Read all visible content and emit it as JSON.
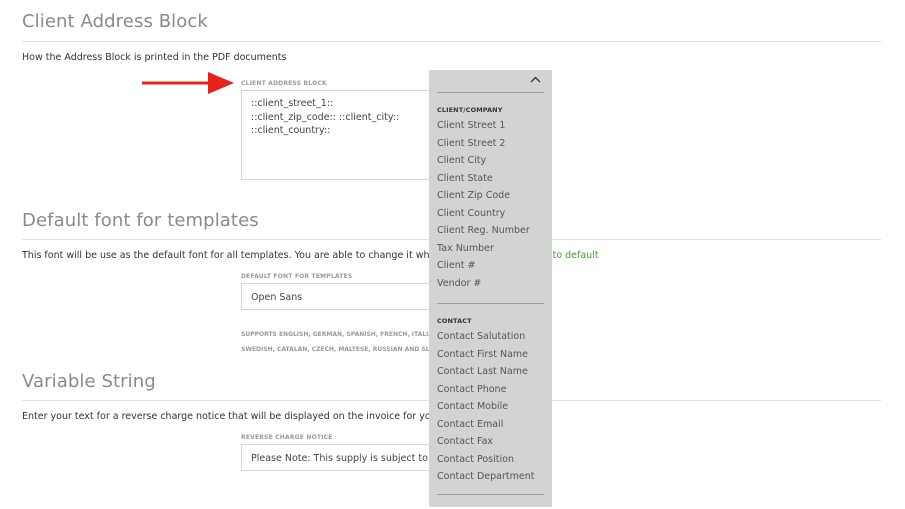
{
  "sections": {
    "address": {
      "title": "Client Address Block",
      "description": "How the Address Block is printed in the PDF documents",
      "field_label": "CLIENT ADDRESS BLOCK",
      "lines": [
        "::client_street_1::",
        "::client_zip_code:: ::client_city::",
        "::client_country::"
      ]
    },
    "font": {
      "title": "Default font for templates",
      "description": "This font will be use as the default font for all templates. You are able to change it when cu",
      "reset_link": "et to default",
      "field_label": "DEFAULT FONT FOR TEMPLATES",
      "value": "Open Sans",
      "help_line1": "SUPPORTS ENGLISH, GERMAN, SPANISH, FRENCH, ITALIA",
      "help_line2": "SWEDISH, CATALAN, CZECH, MALTESE, RUSSIAN AND SLO"
    },
    "variable": {
      "title": "Variable String",
      "description": "Enter your text for a reverse charge notice that will be displayed on the invoice for your cli",
      "field_label": "REVERSE CHARGE NOTICE",
      "value": "Please Note: This supply is subject to th"
    }
  },
  "dropdown": {
    "groups": [
      {
        "title": "CLIENT/COMPANY",
        "items": [
          "Client Street 1",
          "Client Street 2",
          "Client City",
          "Client State",
          "Client Zip Code",
          "Client Country",
          "Client Reg. Number",
          "Tax Number",
          "Client #",
          "Vendor #"
        ]
      },
      {
        "title": "CONTACT",
        "items": [
          "Contact Salutation",
          "Contact First Name",
          "Contact Last Name",
          "Contact Phone",
          "Contact Mobile",
          "Contact Email",
          "Contact Fax",
          "Contact Position",
          "Contact Department"
        ]
      }
    ],
    "toggle_icon": "chevron-up-icon"
  },
  "colors": {
    "arrow": "#e8211b",
    "link": "#4a9a3c",
    "dropdown_bg": "#d3d3d3"
  }
}
